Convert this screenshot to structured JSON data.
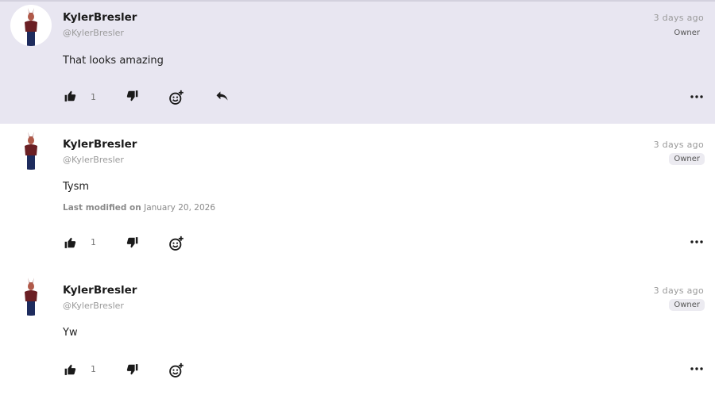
{
  "comments": [
    {
      "username": "KylerBresler",
      "handle": "@KylerBresler",
      "timestamp": "3 days ago",
      "badge": "Owner",
      "body": "That looks amazing",
      "like_count": "1",
      "highlighted": true
    },
    {
      "username": "KylerBresler",
      "handle": "@KylerBresler",
      "timestamp": "3 days ago",
      "badge": "Owner",
      "body": "Tysm",
      "modified_label": "Last modified on",
      "modified_date": "January 20, 2026",
      "like_count": "1"
    },
    {
      "username": "KylerBresler",
      "handle": "@KylerBresler",
      "timestamp": "3 days ago",
      "badge": "Owner",
      "body": "Yw",
      "like_count": "1"
    }
  ],
  "icons": {
    "like": "thumbs-up-icon",
    "dislike": "thumbs-down-icon",
    "react": "add-reaction-icon",
    "reply": "reply-icon",
    "more": "more-options-icon"
  },
  "colors": {
    "highlight_bg": "#e8e6f1",
    "badge_bg": "#ecebf1",
    "text_primary": "#1a1a1a",
    "text_muted": "#9a9a9a"
  }
}
